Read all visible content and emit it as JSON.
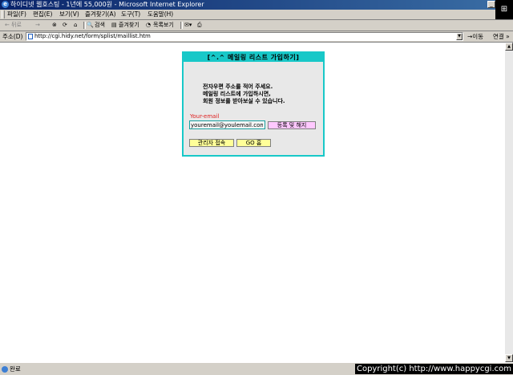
{
  "window": {
    "title": "하이디넷 웹호스팅 - 1년에 55,000원 - Microsoft Internet Explorer",
    "titlebar_color": "#0a246a"
  },
  "menu": {
    "items": [
      "파일(F)",
      "편집(E)",
      "보기(V)",
      "즐겨찾기(A)",
      "도구(T)",
      "도움말(H)"
    ]
  },
  "toolbar": {
    "back_label": "← 뒤로",
    "forward_label": "→",
    "search_label": "검색",
    "favorites_label": "즐겨찾기",
    "history_label": "목록보기"
  },
  "address": {
    "label": "주소(D)",
    "url": "http://cgi.hidy.net/form/splist/maillist.htm",
    "go_label": "이동",
    "links_label": "연결 »"
  },
  "panel": {
    "header": "[^.^ 메일링 리스트 가입하기]",
    "description": [
      "전자우편 주소를 적어 주세요.",
      "메일링 리스트에 가입하시면,",
      "회원 정보를 받아보실 수 있습니다."
    ],
    "email_label": "Your-email",
    "email_value": "youremail@youlemail.com",
    "register_button": "등록 및 해지",
    "admin_button": "관리자 접속",
    "home_button": "GO 홈",
    "accent_color": "#18c8c8"
  },
  "status": {
    "text": "완료",
    "copyright": "Copyright(c) http://www.happycgi.com"
  }
}
